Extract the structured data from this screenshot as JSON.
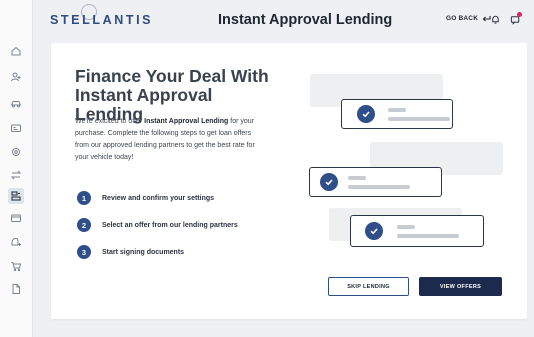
{
  "header": {
    "logo_text": "STELLANTIS",
    "title": "Instant Approval Lending",
    "go_back_label": "GO BACK"
  },
  "sidebar": {
    "items": [
      {
        "icon": "home-icon"
      },
      {
        "icon": "users-icon"
      },
      {
        "icon": "car-icon"
      },
      {
        "icon": "id-card-icon"
      },
      {
        "icon": "settings-icon"
      },
      {
        "icon": "transfer-icon"
      },
      {
        "icon": "lending-icon",
        "active": true
      },
      {
        "icon": "wallet-icon"
      },
      {
        "icon": "vehicle-plus-icon"
      },
      {
        "icon": "cart-icon"
      },
      {
        "icon": "document-icon"
      }
    ]
  },
  "main": {
    "heading": "Finance Your Deal With Instant Approval Lending",
    "intro_prefix": "We're exicited to offer ",
    "intro_bold": "Instant Approval Lending",
    "intro_suffix": " for your purchase. Complete the following steps to get loan offers from our approved lending partners to get the best rate for your vehicle today!",
    "steps": [
      {
        "num": "1",
        "text": "Review and confirm your settings"
      },
      {
        "num": "2",
        "text": "Select an offer from our lending partners"
      },
      {
        "num": "3",
        "text": "Start signing  documents"
      }
    ],
    "buttons": {
      "skip": "SKIP LENDING",
      "view": "VIEW OFFERS"
    }
  },
  "colors": {
    "brand_navy": "#1b2a4d",
    "accent_blue": "#2f4f8a",
    "notification_dot": "#e0245e"
  }
}
